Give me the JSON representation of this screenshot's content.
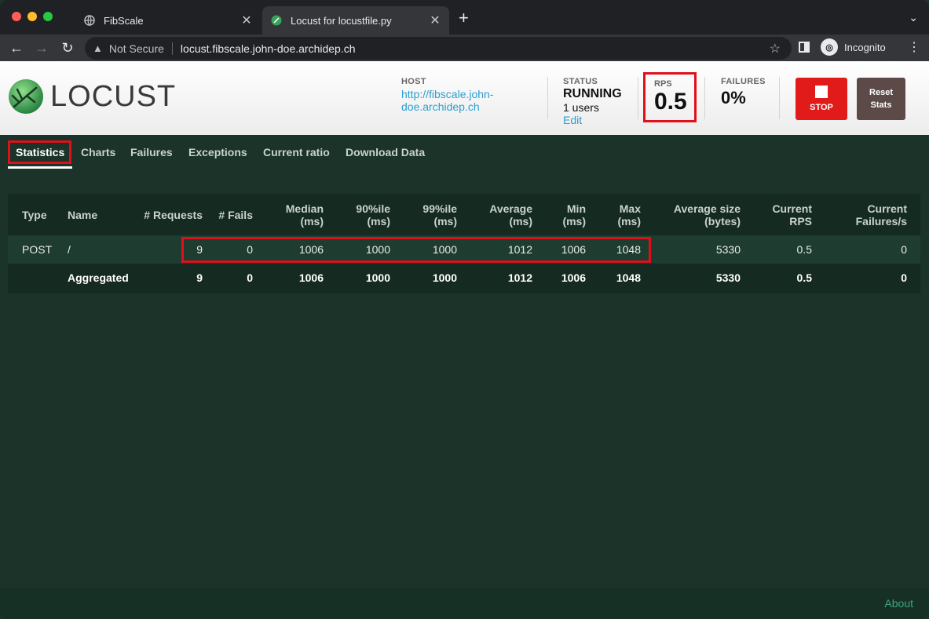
{
  "browser": {
    "tabs": [
      {
        "title": "FibScale",
        "icon": "globe-icon"
      },
      {
        "title": "Locust for locustfile.py",
        "icon": "locust-icon"
      }
    ],
    "omnibox": {
      "security": "Not Secure",
      "url": "locust.fibscale.john-doe.archidep.ch"
    },
    "profile": "Incognito"
  },
  "header": {
    "logo_text": "LOCUST",
    "host_label": "HOST",
    "host_url": "http://fibscale.john-doe.archidep.ch",
    "status_label": "STATUS",
    "status_value": "RUNNING",
    "users": "1 users",
    "edit": "Edit",
    "rps_label": "RPS",
    "rps_value": "0.5",
    "failures_label": "FAILURES",
    "failures_value": "0%",
    "stop_label": "STOP",
    "reset_label": "Reset Stats"
  },
  "nav": {
    "tabs": [
      "Statistics",
      "Charts",
      "Failures",
      "Exceptions",
      "Current ratio",
      "Download Data"
    ]
  },
  "table": {
    "headers": {
      "type": "Type",
      "name": "Name",
      "requests": "# Requests",
      "fails": "# Fails",
      "median_1": "Median",
      "median_2": "(ms)",
      "p90_1": "90%ile",
      "p90_2": "(ms)",
      "p99_1": "99%ile",
      "p99_2": "(ms)",
      "avg_1": "Average",
      "avg_2": "(ms)",
      "min_1": "Min",
      "min_2": "(ms)",
      "max_1": "Max",
      "max_2": "(ms)",
      "size_1": "Average size",
      "size_2": "(bytes)",
      "rps_1": "Current",
      "rps_2": "RPS",
      "fps_1": "Current",
      "fps_2": "Failures/s"
    },
    "rows": [
      {
        "type": "POST",
        "name": "/",
        "requests": "9",
        "fails": "0",
        "median": "1006",
        "p90": "1000",
        "p99": "1000",
        "avg": "1012",
        "min": "1006",
        "max": "1048",
        "size": "5330",
        "rps": "0.5",
        "fps": "0"
      },
      {
        "type": "",
        "name": "Aggregated",
        "requests": "9",
        "fails": "0",
        "median": "1006",
        "p90": "1000",
        "p99": "1000",
        "avg": "1012",
        "min": "1006",
        "max": "1048",
        "size": "5330",
        "rps": "0.5",
        "fps": "0"
      }
    ]
  },
  "footer": {
    "about": "About"
  },
  "colors": {
    "highlight": "#e0101a",
    "background": "#1b3329",
    "stop": "#e11a1a",
    "link": "#2b9fd1"
  }
}
